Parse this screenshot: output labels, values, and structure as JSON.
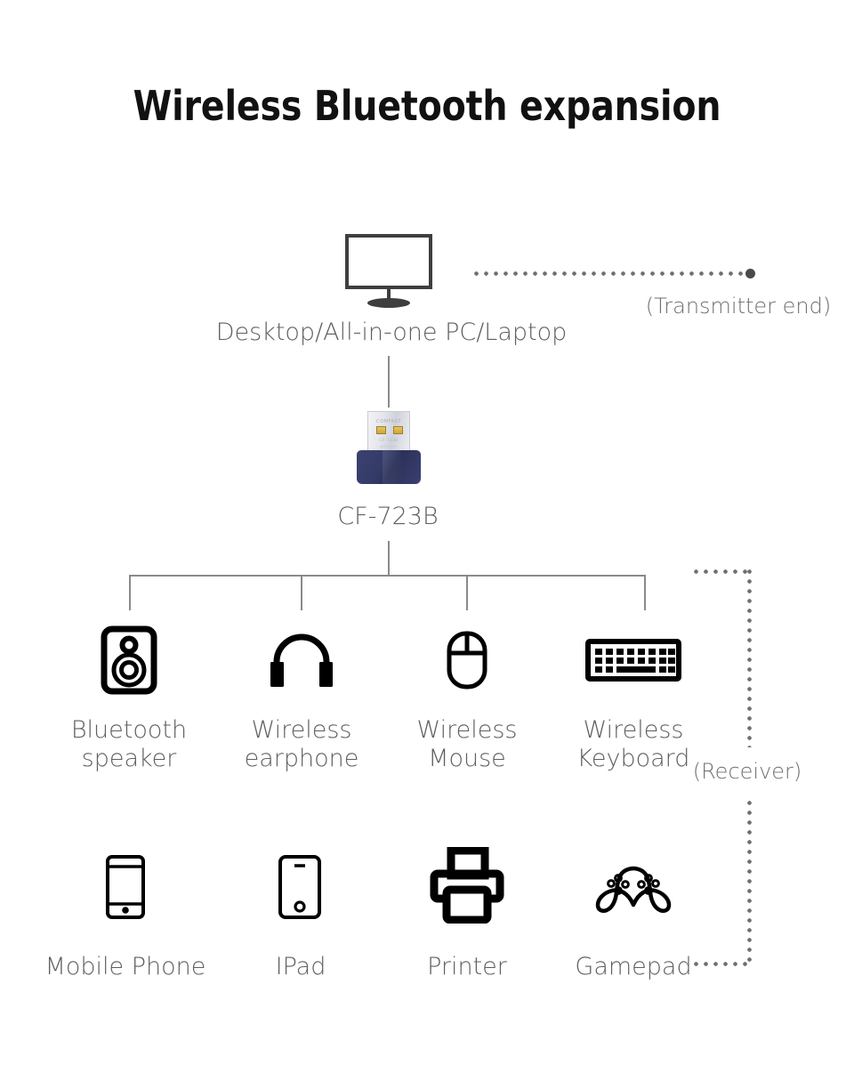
{
  "page": {
    "title": "Wireless Bluetooth expansion",
    "background_color": "#ffffff",
    "line_color": "#8a8a8a",
    "text_color": "#6e6e6e",
    "icon_color": "#000000"
  },
  "source": {
    "label": "Desktop/All-in-one PC/Laptop",
    "icon": "monitor-icon"
  },
  "transmitter": {
    "label": "(Transmitter end)"
  },
  "adapter": {
    "label": "CF-723B",
    "brand_text": "COMFAST",
    "model_text": "CF-723B",
    "sub_text": "WIRELESS",
    "icon": "usb-adapter-icon"
  },
  "receiver": {
    "label": "(Receiver)"
  },
  "devices_row1": [
    {
      "icon": "bluetooth-speaker-icon",
      "label": "Bluetooth\nspeaker"
    },
    {
      "icon": "wireless-earphone-icon",
      "label": "Wireless\nearphone"
    },
    {
      "icon": "wireless-mouse-icon",
      "label": "Wireless\nMouse"
    },
    {
      "icon": "wireless-keyboard-icon",
      "label": "Wireless\nKeyboard"
    }
  ],
  "devices_row2": [
    {
      "icon": "mobile-phone-icon",
      "label": "Mobile Phone"
    },
    {
      "icon": "ipad-icon",
      "label": "IPad"
    },
    {
      "icon": "printer-icon",
      "label": "Printer"
    },
    {
      "icon": "gamepad-icon",
      "label": "Gamepad"
    }
  ]
}
